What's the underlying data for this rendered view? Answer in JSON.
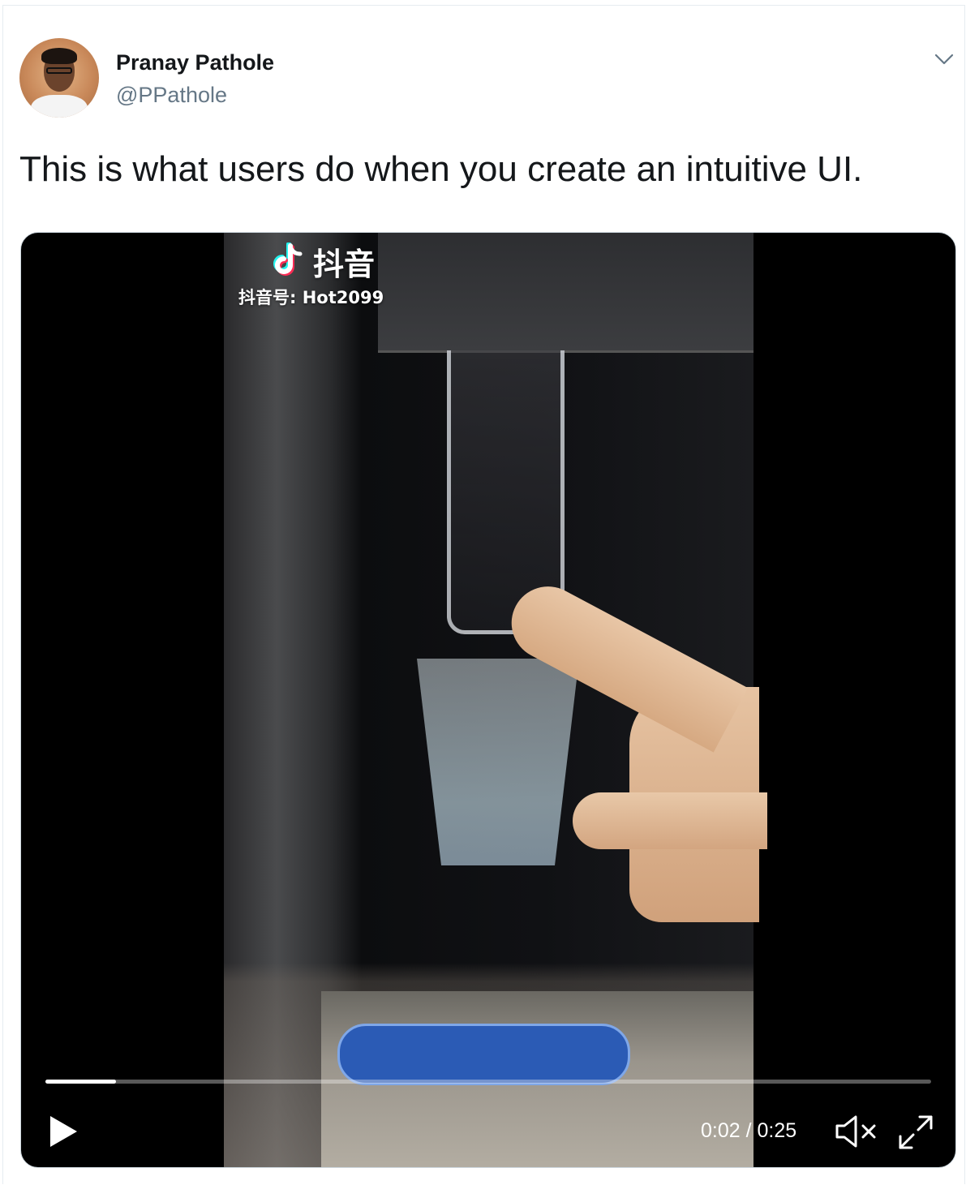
{
  "author": {
    "name": "Pranay Pathole",
    "handle": "@PPathole"
  },
  "tweet": {
    "text": "This is what users do when you create an intuitive UI."
  },
  "video": {
    "overlay_brand": "抖音",
    "overlay_id": "抖音号: Hot2099",
    "current_time": "0:02",
    "separator": " / ",
    "duration": "0:25",
    "progress_fraction": 0.08,
    "muted": true
  },
  "icons": {
    "menu": "chevron-down-icon",
    "play": "play-icon",
    "mute": "speaker-muted-icon",
    "fullscreen": "expand-icon",
    "brand_logo": "tiktok-logo-icon"
  },
  "colors": {
    "name_text": "#14171a",
    "secondary_text": "#657786",
    "chevron": "#657786",
    "video_bg": "#000000",
    "controls": "#ffffff"
  }
}
